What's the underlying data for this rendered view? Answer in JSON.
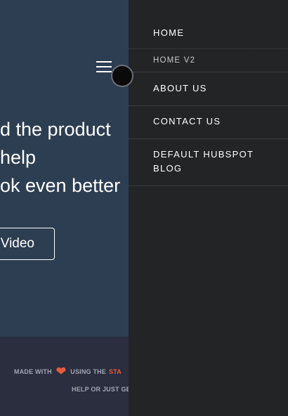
{
  "hero": {
    "lines": [
      "d the product",
      "help",
      "ok even better"
    ],
    "button_label": "Video"
  },
  "footer": {
    "made_with": "MADE WITH",
    "heart_icon": "heart-icon",
    "using_the": "USING THE",
    "accent_text": "STA",
    "line2": "HELP OR JUST GE",
    "accent_color": "#e85b3c"
  },
  "nav_toggle": {
    "icon": "hamburger-menu-icon"
  },
  "menu": {
    "items": [
      {
        "label": "HOME"
      },
      {
        "label": "HOME V2"
      },
      {
        "label": "ABOUT US"
      },
      {
        "label": "CONTACT US"
      },
      {
        "label": "DEFAULT HUBSPOT\nBLOG"
      }
    ]
  }
}
